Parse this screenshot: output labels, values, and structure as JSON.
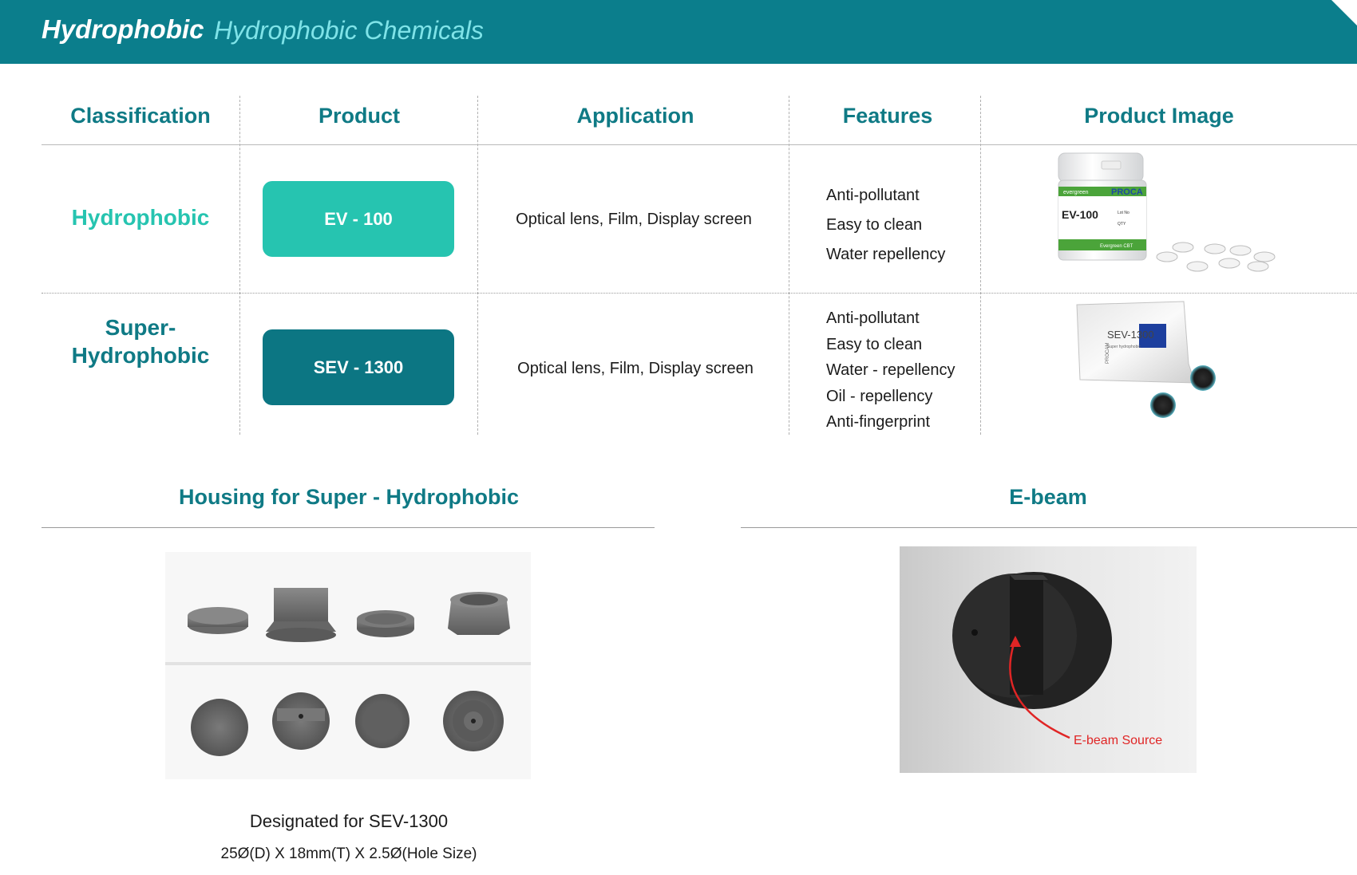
{
  "header": {
    "title": "Hydrophobic",
    "subtitle": "Hydrophobic Chemicals"
  },
  "colors": {
    "banner": "#0b7e8c",
    "accent_teal": "#0f7a85",
    "light_teal": "#26c4b0",
    "dark_pill": "#0c7683"
  },
  "table": {
    "headers": [
      "Classification",
      "Product",
      "Application",
      "Features",
      "Product Image"
    ],
    "rows": [
      {
        "classification": "Hydrophobic",
        "product": "EV - 100",
        "application": "Optical lens, Film, Display screen",
        "features": [
          "Anti-pollutant",
          "Easy to clean",
          "Water repellency"
        ],
        "image": {
          "icon": "ev-100-jar-image",
          "labels": {
            "brand": "evergreen",
            "brand_name": "PROCA",
            "product": "EV-100",
            "lot": "Lot No",
            "qty": "QTY",
            "maker": "Evergreen CBT"
          }
        }
      },
      {
        "classification_line1": "Super-",
        "classification_line2": "Hydrophobic",
        "product": "SEV - 1300",
        "application": "Optical lens, Film, Display screen",
        "features": [
          "Anti-pollutant",
          "Easy to clean",
          "Water - repellency",
          "Oil - repellency",
          "Anti-fingerprint"
        ],
        "image": {
          "icon": "sev-1300-pouch-image",
          "labels": {
            "brand": "PROCAM",
            "product": "SEV-1300",
            "desc": "Super hydrophobic"
          }
        }
      }
    ]
  },
  "housing": {
    "title": "Housing for Super - Hydrophobic",
    "caption_line1": "Designated for SEV-1300",
    "caption_line2": "25Ø(D) X 18mm(T) X 2.5Ø(Hole Size)"
  },
  "ebeam": {
    "title": "E-beam",
    "source_label": "E-beam Source"
  }
}
